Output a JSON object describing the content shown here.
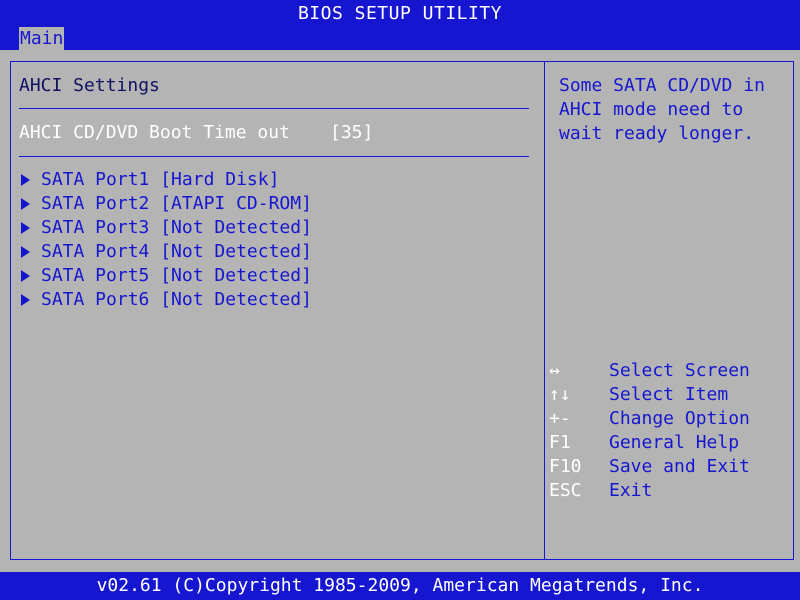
{
  "title": "BIOS SETUP UTILITY",
  "menu": {
    "tabs": [
      {
        "label": "Main"
      }
    ]
  },
  "section": {
    "heading": "AHCI Settings",
    "setting": {
      "label": "AHCI CD/DVD Boot Time out",
      "value": "[35]"
    },
    "ports": [
      {
        "name": "SATA Port1",
        "status": "[Hard Disk]"
      },
      {
        "name": "SATA Port2",
        "status": "[ATAPI CD-ROM]"
      },
      {
        "name": "SATA Port3",
        "status": "[Not Detected]"
      },
      {
        "name": "SATA Port4",
        "status": "[Not Detected]"
      },
      {
        "name": "SATA Port5",
        "status": "[Not Detected]"
      },
      {
        "name": "SATA Port6",
        "status": "[Not Detected]"
      }
    ]
  },
  "help": {
    "lines": [
      "Some SATA CD/DVD in",
      "AHCI mode need to",
      "wait ready longer."
    ]
  },
  "keys": [
    {
      "key": "↔",
      "action": "Select Screen"
    },
    {
      "key": "↑↓",
      "action": "Select Item"
    },
    {
      "key": "+-",
      "action": "Change Option"
    },
    {
      "key": "F1",
      "action": "General Help"
    },
    {
      "key": "F10",
      "action": "Save and Exit"
    },
    {
      "key": "ESC",
      "action": "Exit"
    }
  ],
  "footer": "v02.61 (C)Copyright 1985-2009, American Megatrends, Inc.",
  "colors": {
    "background": "#b4b4b4",
    "accent_blue": "#1616d0",
    "highlight_white": "#ffffff",
    "text_dark": "#101060"
  }
}
